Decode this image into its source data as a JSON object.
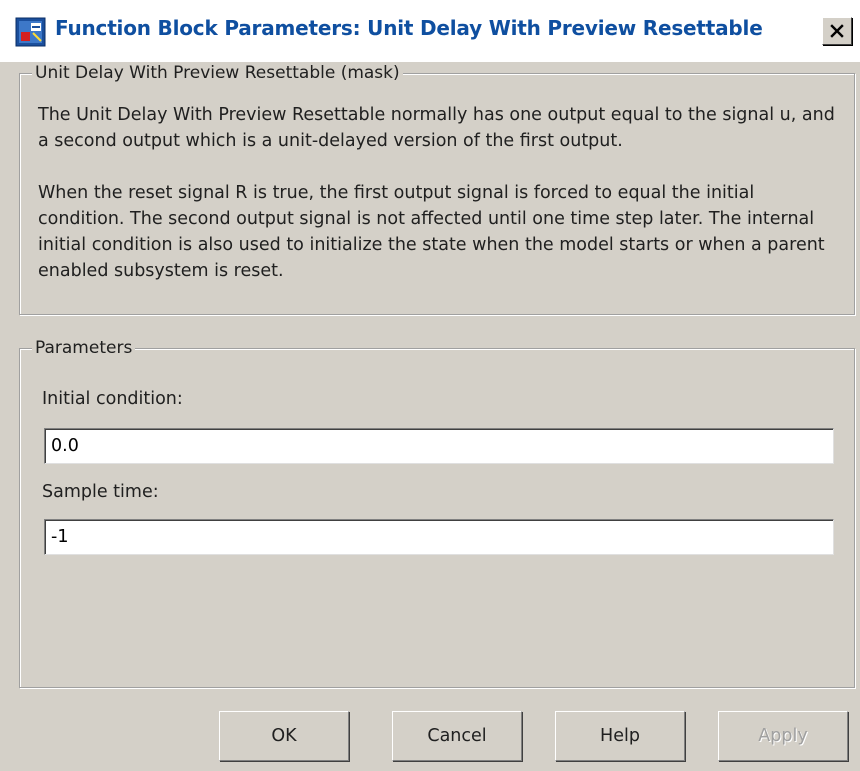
{
  "window": {
    "title": "Function Block Parameters: Unit Delay With Preview Resettable",
    "close_icon": "close-icon",
    "app_icon": "simulink-block-icon"
  },
  "mask_group": {
    "legend": "Unit Delay With Preview Resettable (mask)",
    "description_1": "The Unit Delay With Preview Resettable normally has one output equal to the signal u, and a second output which is a unit-delayed version of the first output.",
    "description_2": "When the reset signal R is true, the first output signal is forced to equal the initial condition.  The second output signal is not affected until one time step later.  The internal initial condition is also used to initialize the state when the model starts or when a parent enabled subsystem is reset."
  },
  "parameters": {
    "legend": "Parameters",
    "initial_condition": {
      "label": "Initial condition:",
      "value": "0.0"
    },
    "sample_time": {
      "label": "Sample time:",
      "value": "-1"
    }
  },
  "buttons": {
    "ok": "OK",
    "cancel": "Cancel",
    "help": "Help",
    "apply": "Apply"
  },
  "colors": {
    "dialog_bg": "#d4d0c8",
    "title_text": "#0f4fa0",
    "disabled_text": "#a0a0a0"
  }
}
